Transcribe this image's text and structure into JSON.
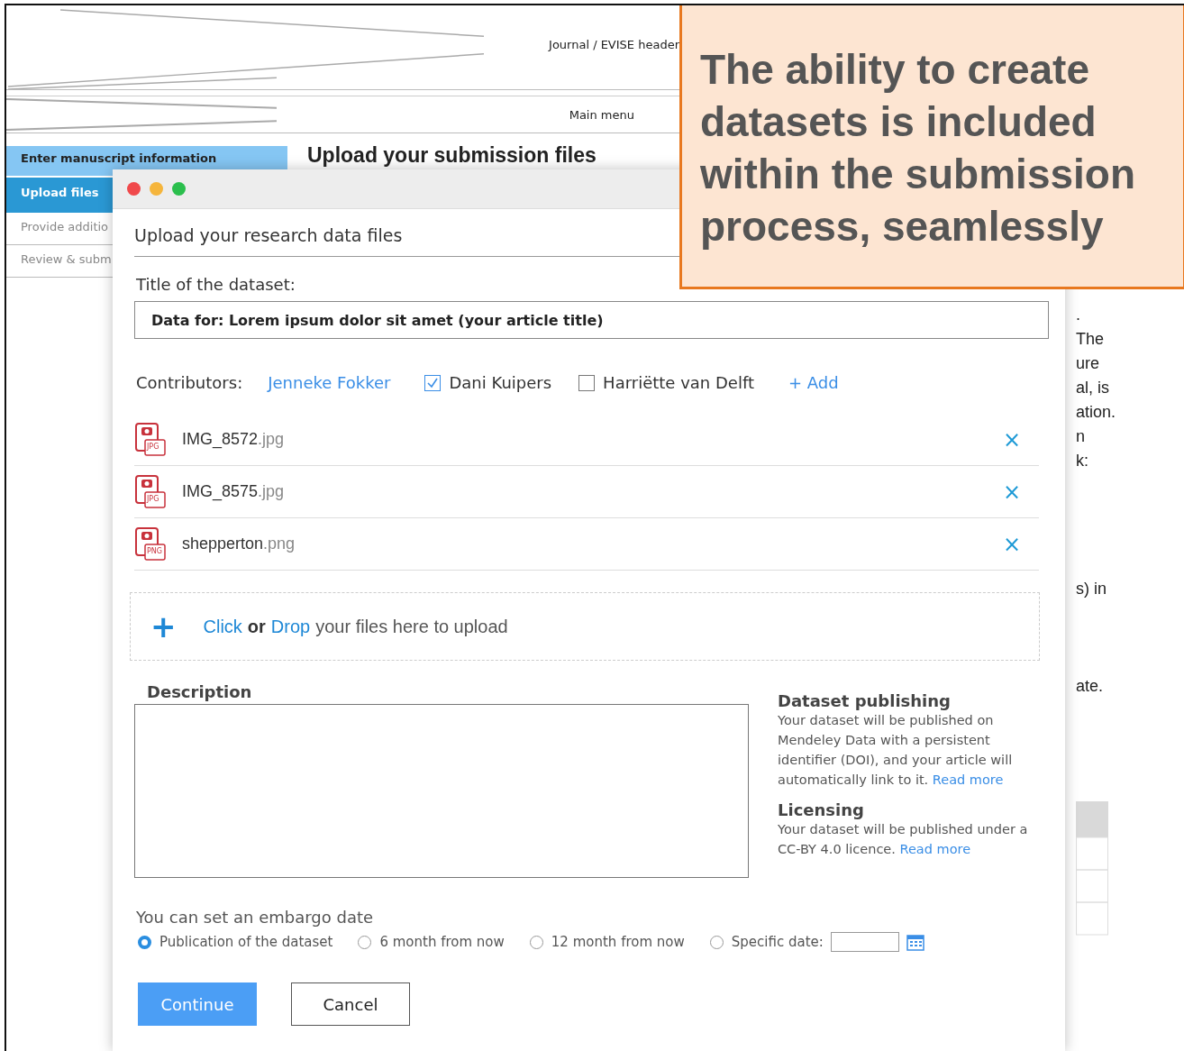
{
  "page": {
    "header": "Journal  / EVISE header",
    "menu": "Main menu",
    "sidebar": {
      "items": [
        {
          "label": "Enter manuscript information",
          "selected": false,
          "completed": true
        },
        {
          "label": "Upload files",
          "selected": true,
          "completed": false
        },
        {
          "label": "Provide additio",
          "selected": false,
          "completed": false
        },
        {
          "label": "Review & subm",
          "selected": false,
          "completed": false
        }
      ]
    },
    "heading": "Upload your submission files",
    "text_fragments": [
      ".",
      "The",
      "ure",
      "al, is",
      "ation.",
      "n",
      "k:",
      "s) in",
      "ate."
    ]
  },
  "dialog": {
    "title": "Upload your research data files",
    "dataset_title": {
      "label": "Title of the dataset:",
      "value": "Data for: Lorem ipsum dolor sit amet (your article title)"
    },
    "contributors": {
      "label": "Contributors:",
      "people": [
        {
          "name": "Jenneke Fokker",
          "kind": "link"
        },
        {
          "name": "Dani Kuipers",
          "kind": "checkbox",
          "checked": true
        },
        {
          "name": "Harriëtte van Delft",
          "kind": "checkbox",
          "checked": false
        }
      ],
      "add": "+ Add"
    },
    "files": [
      {
        "name": "IMG_8572",
        "ext": ".jpg",
        "type": "JPG",
        "remove": "×"
      },
      {
        "name": "IMG_8575",
        "ext": ".jpg",
        "type": "JPG",
        "remove": "×"
      },
      {
        "name": "shepperton",
        "ext": ".png",
        "type": "PNG",
        "remove": "×"
      }
    ],
    "dropzone": {
      "icon": "+",
      "click": "Click",
      "or": "or",
      "drop": "Drop",
      "rest": "your files here to upload"
    },
    "description": {
      "label": "Description"
    },
    "info": [
      {
        "title": "Dataset publishing",
        "text": "Your dataset will be published on Mendeley Data with a persistent identifier (DOI), and your article will automatically link to it.",
        "link": "Read more"
      },
      {
        "title": "Licensing",
        "text": "Your dataset will be published under a CC-BY 4.0 licence.",
        "link": "Read more"
      }
    ],
    "embargo": {
      "label": "You can set an embargo date",
      "options": [
        {
          "label": "Publication of the dataset",
          "selected": true,
          "kind": "radio"
        },
        {
          "label": "6 month from now",
          "selected": false,
          "kind": "radio"
        },
        {
          "label": "12 month from now",
          "selected": false,
          "kind": "radio"
        },
        {
          "label": "Specific date:",
          "selected": false,
          "kind": "date"
        }
      ]
    },
    "buttons": [
      {
        "label": "Continue",
        "kind": "primary"
      },
      {
        "label": "Cancel",
        "kind": "secondary"
      }
    ]
  },
  "callout": {
    "text": "The ability to create datasets is included within the submission process, seamlessly"
  }
}
